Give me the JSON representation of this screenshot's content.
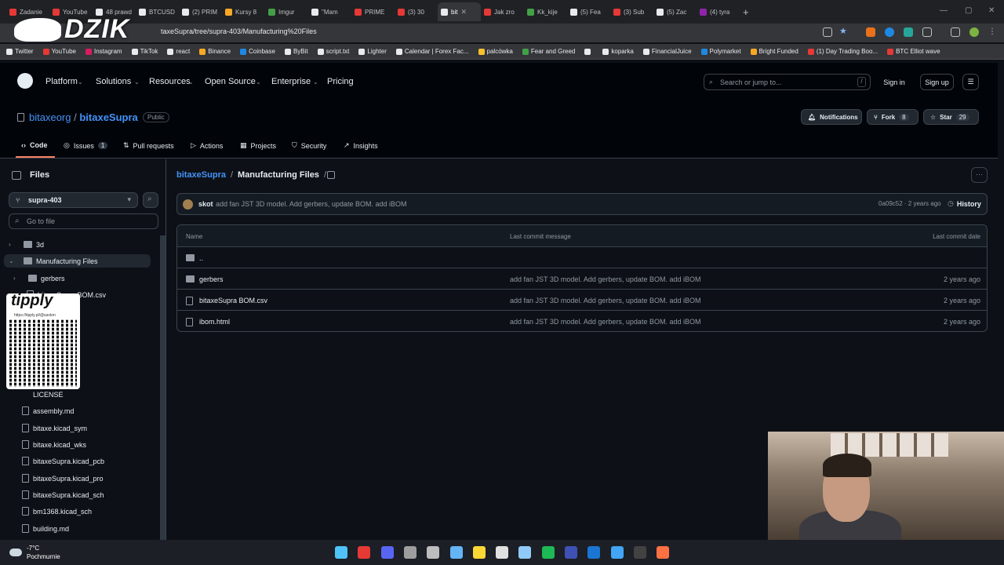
{
  "browser": {
    "tabs": [
      {
        "label": "Zadanie",
        "color": "#e53935"
      },
      {
        "label": "YouTube",
        "color": "#e53935"
      },
      {
        "label": "48 prawd",
        "color": "#e8eaed"
      },
      {
        "label": "BTCUSD",
        "color": "#e8eaed"
      },
      {
        "label": "(2) PRIM",
        "color": "#e8eaed"
      },
      {
        "label": "Kursy 8",
        "color": "#f9a825"
      },
      {
        "label": "Imgur",
        "color": "#43a047"
      },
      {
        "label": "\"Mam",
        "color": "#e8eaed"
      },
      {
        "label": "PRIME",
        "color": "#e53935"
      },
      {
        "label": "(3) 30",
        "color": "#e53935"
      },
      {
        "label": "bit",
        "color": "#e8eaed",
        "active": true
      },
      {
        "label": "Jak zro",
        "color": "#e53935"
      },
      {
        "label": "Kk_kije",
        "color": "#43a047"
      },
      {
        "label": "(5) Fea",
        "color": "#e8eaed"
      },
      {
        "label": "(3) Sub",
        "color": "#e53935"
      },
      {
        "label": "(5) Zac",
        "color": "#e8eaed"
      },
      {
        "label": "(4) tyra",
        "color": "#8e24aa"
      }
    ],
    "new_tab": "+",
    "url": "taxeSupra/tree/supra-403/Manufacturing%20Files",
    "bookmarks": [
      {
        "label": "Twitter",
        "color": "#e8eaed"
      },
      {
        "label": "YouTube",
        "color": "#e53935"
      },
      {
        "label": "Instagram",
        "color": "#d81b60"
      },
      {
        "label": "TikTok",
        "color": "#e8eaed"
      },
      {
        "label": "react",
        "color": "#e8eaed"
      },
      {
        "label": "Binance",
        "color": "#f9a825"
      },
      {
        "label": "Coinbase",
        "color": "#1e88e5"
      },
      {
        "label": "ByBit",
        "color": "#e8eaed"
      },
      {
        "label": "script.txt",
        "color": "#e8eaed"
      },
      {
        "label": "Lighter",
        "color": "#e8eaed"
      },
      {
        "label": "Calendar | Forex Fac...",
        "color": "#e8eaed"
      },
      {
        "label": "palcówka",
        "color": "#fbc02d"
      },
      {
        "label": "Fear and Greed",
        "color": "#43a047"
      },
      {
        "label": "",
        "color": "#e8eaed"
      },
      {
        "label": "koparka",
        "color": "#e8eaed"
      },
      {
        "label": "FinancialJuice",
        "color": "#e8eaed"
      },
      {
        "label": "Polymarket",
        "color": "#1e88e5"
      },
      {
        "label": "Bright Funded",
        "color": "#f9a825"
      },
      {
        "label": "(1) Day Trading Boo...",
        "color": "#e53935"
      },
      {
        "label": "BTC Elliot wave",
        "color": "#e53935"
      }
    ],
    "overlay_logo": "DZIK"
  },
  "github": {
    "nav": [
      "Platform",
      "Solutions",
      "Resources",
      "Open Source",
      "Enterprise",
      "Pricing"
    ],
    "search_placeholder": "Search or jump to...",
    "search_shortcut": "/",
    "sign_in": "Sign in",
    "sign_up": "Sign up",
    "repo": {
      "owner": "bitaxeorg",
      "sep": "/",
      "name": "bitaxeSupra",
      "visibility": "Public",
      "notifications": "Notifications",
      "fork": "Fork",
      "fork_count": "8",
      "star": "Star",
      "star_count": "29"
    },
    "tabs": [
      {
        "label": "Code"
      },
      {
        "label": "Issues",
        "count": "1"
      },
      {
        "label": "Pull requests"
      },
      {
        "label": "Actions"
      },
      {
        "label": "Projects"
      },
      {
        "label": "Security"
      },
      {
        "label": "Insights"
      }
    ]
  },
  "sidebar": {
    "title": "Files",
    "branch": "supra-403",
    "goto_placeholder": "Go to file",
    "tree": [
      {
        "label": "3d",
        "type": "dir",
        "expanded": false
      },
      {
        "label": "Manufacturing Files",
        "type": "dir",
        "expanded": true,
        "selected": true
      },
      {
        "label": "gerbers",
        "type": "dir",
        "expanded": false
      },
      {
        "label": "bitaxeSupra BOM.csv",
        "type": "file"
      },
      {
        "label": "LICENSE",
        "type": "file"
      },
      {
        "label": "assembly.md",
        "type": "file"
      },
      {
        "label": "bitaxe.kicad_sym",
        "type": "file"
      },
      {
        "label": "bitaxe.kicad_wks",
        "type": "file"
      },
      {
        "label": "bitaxeSupra.kicad_pcb",
        "type": "file"
      },
      {
        "label": "bitaxeSupra.kicad_pro",
        "type": "file"
      },
      {
        "label": "bitaxeSupra.kicad_sch",
        "type": "file"
      },
      {
        "label": "bm1368.kicad_sch",
        "type": "file"
      },
      {
        "label": "building.md",
        "type": "file"
      }
    ],
    "overlay": {
      "brand": "tipply",
      "url": "https://tipply.pl/@saxton"
    }
  },
  "main": {
    "breadcrumb": {
      "root": "bitaxeSupra",
      "sep": "/",
      "current": "Manufacturing Files",
      "trail": "/"
    },
    "more": "···",
    "commit": {
      "author": "skot",
      "message": "add fan JST 3D model. Add gerbers, update BOM. add iBOM",
      "meta": "0a09c52 · 2 years ago",
      "history": "History"
    },
    "columns": {
      "name": "Name",
      "message": "Last commit message",
      "date": "Last commit date"
    },
    "rows": [
      {
        "name": "..",
        "type": "parent",
        "message": "",
        "date": ""
      },
      {
        "name": "gerbers",
        "type": "dir",
        "message": "add fan JST 3D model. Add gerbers, update BOM. add iBOM",
        "date": "2 years ago"
      },
      {
        "name": "bitaxeSupra BOM.csv",
        "type": "file",
        "message": "add fan JST 3D model. Add gerbers, update BOM. add iBOM",
        "date": "2 years ago"
      },
      {
        "name": "ibom.html",
        "type": "file",
        "message": "add fan JST 3D model. Add gerbers, update BOM. add iBOM",
        "date": "2 years ago"
      }
    ]
  },
  "taskbar": {
    "weather_temp": "-7°C",
    "weather_desc": "Pochmurnie",
    "icons": [
      {
        "name": "windows-start-icon",
        "color": "#4fc3f7"
      },
      {
        "name": "chrome-icon",
        "color": "#e53935"
      },
      {
        "name": "discord-icon",
        "color": "#5865f2"
      },
      {
        "name": "media-icon",
        "color": "#9e9e9e"
      },
      {
        "name": "settings-icon",
        "color": "#bdbdbd"
      },
      {
        "name": "steam-icon",
        "color": "#64b5f6"
      },
      {
        "name": "explorer-icon",
        "color": "#fdd835"
      },
      {
        "name": "app-icon",
        "color": "#e0e0e0"
      },
      {
        "name": "network-icon",
        "color": "#90caf9"
      },
      {
        "name": "spotify-icon",
        "color": "#1db954"
      },
      {
        "name": "app2-icon",
        "color": "#3f51b5"
      },
      {
        "name": "notes-icon",
        "color": "#1976d2"
      },
      {
        "name": "photos-icon",
        "color": "#42a5f5"
      },
      {
        "name": "terminal-icon",
        "color": "#424242"
      },
      {
        "name": "obs-icon",
        "color": "#ff7043"
      }
    ]
  }
}
